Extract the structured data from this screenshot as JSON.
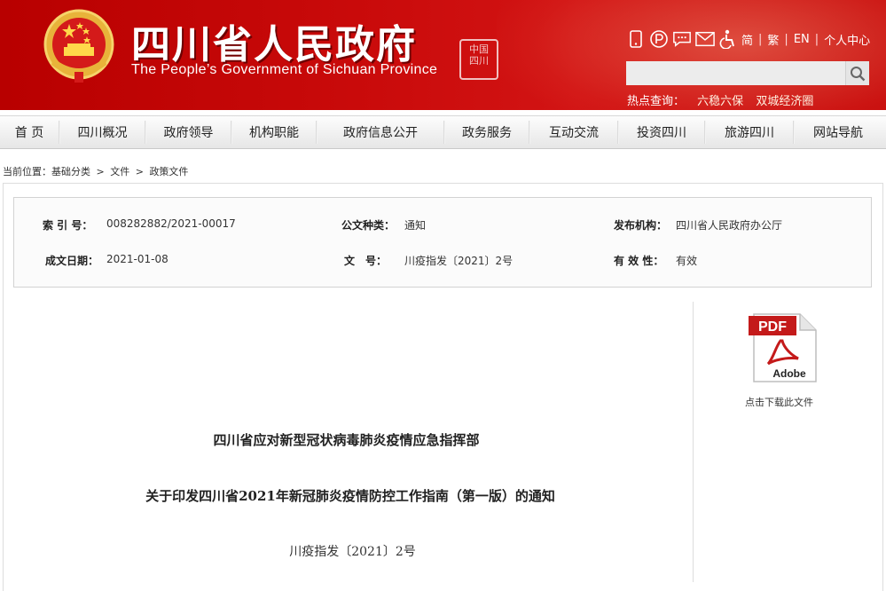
{
  "header": {
    "title_cn": "四川省人民政府",
    "title_en": "The People’s Government of Sichuan Province",
    "seal_text": "中国四川",
    "tools": {
      "simplified": "简",
      "traditional": "繁",
      "english": "EN",
      "personal_center": "个人中心"
    },
    "search": {
      "placeholder": ""
    },
    "hot_label": "热点查询：",
    "hot_links": [
      "六稳六保",
      "双城经济圈"
    ]
  },
  "nav": {
    "items": [
      "首 页",
      "四川概况",
      "政府领导",
      "机构职能",
      "政府信息公开",
      "政务服务",
      "互动交流",
      "投资四川",
      "旅游四川",
      "网站导航"
    ]
  },
  "breadcrumb": {
    "label": "当前位置：",
    "items": [
      "基础分类",
      "文件",
      "政策文件"
    ],
    "separator": ">"
  },
  "meta": {
    "index_label": "索 引 号：",
    "index_value": "008282882/2021-00017",
    "doctype_label": "公文种类：",
    "doctype_value": "通知",
    "publisher_label": "发布机构：",
    "publisher_value": "四川省人民政府办公厅",
    "date_label": "成文日期：",
    "date_value": "2021-01-08",
    "docno_label": "文　号：",
    "docno_value": "川疫指发〔2021〕2号",
    "validity_label": "有 效 性：",
    "validity_value": "有效"
  },
  "sidebar": {
    "pdf_badge": "PDF",
    "pdf_brand": "Adobe",
    "download_caption": "点击下载此文件"
  },
  "document": {
    "title_line1": "四川省应对新型冠状病毒肺炎疫情应急指挥部",
    "title_line2": "关于印发四川省2021年新冠肺炎疫情防控工作指南（第一版）的通知",
    "doc_number": "川疫指发〔2021〕2号"
  },
  "colors": {
    "header_red": "#c90a0a",
    "nav_bg": "#eeeeee"
  }
}
